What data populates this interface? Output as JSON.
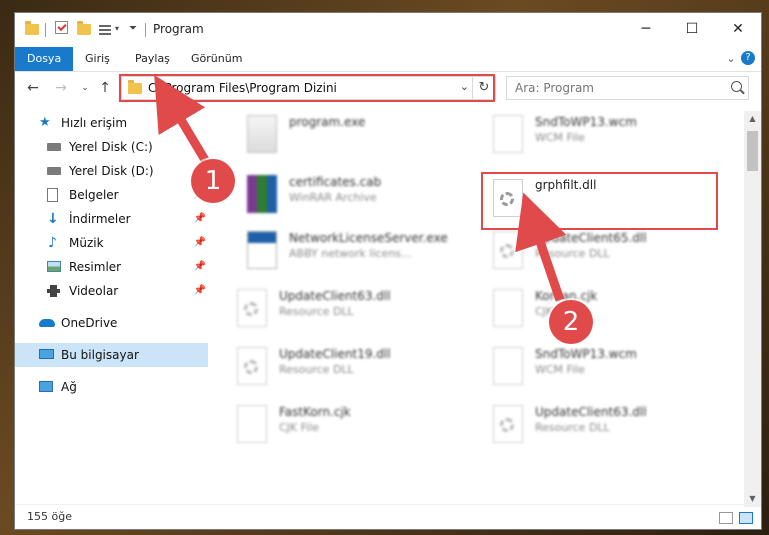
{
  "window": {
    "title": "Program",
    "controls": {
      "minimize": "─",
      "maximize": "☐",
      "close": "✕"
    }
  },
  "ribbon": {
    "tabs": [
      "Dosya",
      "Giriş",
      "Paylaş",
      "Görünüm"
    ],
    "help": "?"
  },
  "nav": {
    "address": "C:\\Program Files\\Program Dizini",
    "search_placeholder": "Ara: Program"
  },
  "sidebar": {
    "items": [
      {
        "label": "Hızlı erişim",
        "icon": "star-icon"
      },
      {
        "label": "Yerel Disk (C:)",
        "icon": "drive-icon"
      },
      {
        "label": "Yerel Disk (D:)",
        "icon": "drive-icon"
      },
      {
        "label": "Belgeler",
        "icon": "documents-icon",
        "pinned": true
      },
      {
        "label": "İndirmeler",
        "icon": "download-icon",
        "pinned": true
      },
      {
        "label": "Müzik",
        "icon": "music-icon",
        "pinned": true
      },
      {
        "label": "Resimler",
        "icon": "pictures-icon",
        "pinned": true
      },
      {
        "label": "Videolar",
        "icon": "videos-icon",
        "pinned": true
      },
      {
        "label": "OneDrive",
        "icon": "cloud-icon"
      },
      {
        "label": "Bu bilgisayar",
        "icon": "computer-icon",
        "selected": true
      },
      {
        "label": "Ağ",
        "icon": "network-icon"
      }
    ]
  },
  "files": [
    {
      "name": "program.exe",
      "type": ""
    },
    {
      "name": "SndToWP13.wcm",
      "type": "WCM File"
    },
    {
      "name": "certificates.cab",
      "type": "WinRAR Archive"
    },
    {
      "name": "grphfilt.dll",
      "type": ""
    },
    {
      "name": "NetworkLicenseServer.exe",
      "type": "ABBY network licens..."
    },
    {
      "name": "UpdateClient65.dll",
      "type": "Resource DLL"
    },
    {
      "name": "UpdateClient63.dll",
      "type": "Resource DLL"
    },
    {
      "name": "Korean.cjk",
      "type": "CJK File"
    },
    {
      "name": "UpdateClient19.dll",
      "type": "Resource DLL"
    },
    {
      "name": "SndToWP13.wcm",
      "type": "WCM File"
    },
    {
      "name": "FastKorn.cjk",
      "type": "CJK File"
    },
    {
      "name": "UpdateClient63.dll",
      "type": "Resource DLL"
    }
  ],
  "status": {
    "count": "155 öğe"
  },
  "annotations": {
    "badge1": "1",
    "badge2": "2",
    "color": "#e04a4a"
  },
  "colors": {
    "accent": "#1979ca",
    "selected_bg": "#cce4f7"
  }
}
